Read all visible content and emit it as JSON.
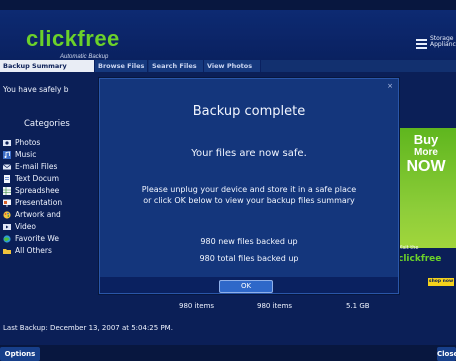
{
  "app": {
    "logo_text": "clickfree",
    "logo_tagline": "Automatic Backup",
    "partner_logo": "Storage Appliance"
  },
  "tabs": [
    {
      "label": "Backup Summary",
      "active": true
    },
    {
      "label": "Browse Files",
      "active": false
    },
    {
      "label": "Search Files",
      "active": false
    },
    {
      "label": "View Photos",
      "active": false
    }
  ],
  "summary": {
    "safely_text": "You have safely b",
    "categories_heading": "Categories",
    "categories": [
      {
        "label": "Photos",
        "icon": "photo-icon"
      },
      {
        "label": "Music",
        "icon": "music-icon"
      },
      {
        "label": "E-mail Files",
        "icon": "email-icon"
      },
      {
        "label": "Text Docum",
        "icon": "text-document-icon"
      },
      {
        "label": "Spreadshee",
        "icon": "spreadsheet-icon"
      },
      {
        "label": "Presentation",
        "icon": "presentation-icon"
      },
      {
        "label": "Artwork and",
        "icon": "artwork-icon"
      },
      {
        "label": "Video",
        "icon": "video-icon"
      },
      {
        "label": "Favorite We",
        "icon": "favorite-web-icon"
      },
      {
        "label": "All Others",
        "icon": "all-others-icon"
      }
    ],
    "totals": {
      "items_a": "980 items",
      "items_b": "980 items",
      "size": "5.1 GB"
    },
    "last_backup": "Last Backup: December 13, 2007 at 5:04:25 PM."
  },
  "ad": {
    "buy": "Buy",
    "more": "More",
    "now": "NOW",
    "visit": "Visit the",
    "logo": "clickfree",
    "shop": "shop now"
  },
  "dialog": {
    "close_glyph": "×",
    "title": "Backup complete",
    "safe_message": "Your files are now safe.",
    "instruction_line1": "Please unplug your device and store it in a safe place",
    "instruction_line2": "or click OK below to view your backup files summary",
    "new_files": "980 new files backed up",
    "total_files": "980 total files backed up",
    "ok_label": "OK"
  },
  "footer": {
    "options_label": "Options",
    "close_label": "Close"
  },
  "colors": {
    "background": "#0b1f57",
    "logo_green": "#6bd12a",
    "dialog": "#14367c",
    "ok_button": "#2f68c9"
  }
}
